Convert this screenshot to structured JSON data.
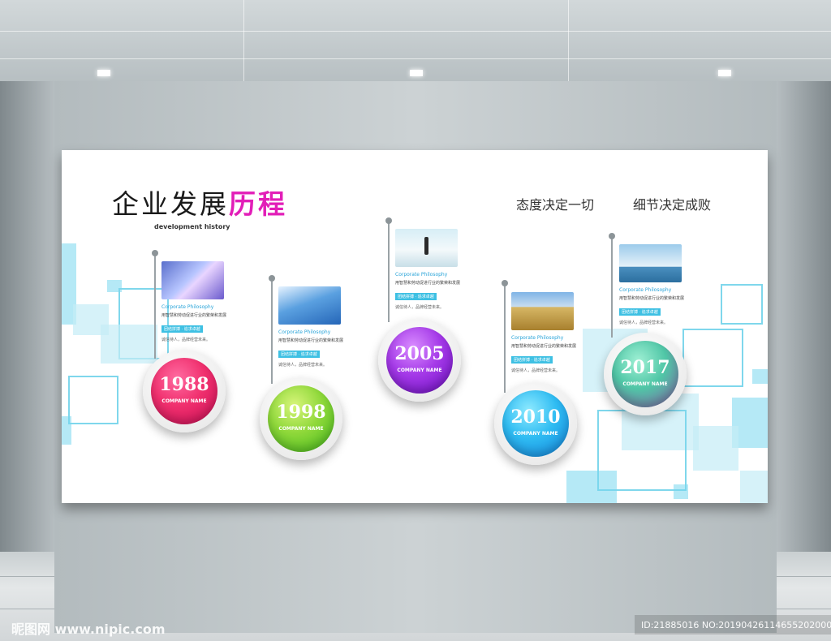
{
  "board": {
    "title_main": "企业发展",
    "title_accent": "历程",
    "subtitle": "development history",
    "slogan_1": "态度决定一切",
    "slogan_2": "细节决定成败"
  },
  "milestones": [
    {
      "year": "1988",
      "company": "COMPANY NAME",
      "photo": "handshake-photo",
      "color_top": "#f0306e",
      "color_bottom": "#d0105a",
      "philosophy": "Corporate Philosophy",
      "desc": "用智慧和劳动促进行业的繁荣和发展",
      "tag": "团结拼搏 · 追求卓越",
      "note": "诚信待人，品牌经营未来。"
    },
    {
      "year": "1998",
      "company": "COMPANY NAME",
      "photo": "building-photo",
      "color_top": "#b4e03a",
      "color_bottom": "#52c21a",
      "philosophy": "Corporate Philosophy",
      "desc": "用智慧和劳动促进行业的繁荣和发展",
      "tag": "团结拼搏 · 追求卓越",
      "note": "诚信待人，品牌经营未来。"
    },
    {
      "year": "2005",
      "company": "COMPANY NAME",
      "photo": "businessman-photo",
      "color_top": "#b83ef0",
      "color_bottom": "#7a12c8",
      "philosophy": "Corporate Philosophy",
      "desc": "用智慧和劳动促进行业的繁荣和发展",
      "tag": "团结拼搏 · 追求卓越",
      "note": "诚信待人，品牌经营未来。"
    },
    {
      "year": "2010",
      "company": "COMPANY NAME",
      "photo": "wheat-photo",
      "color_top": "#3fd0f5",
      "color_bottom": "#1a86e0",
      "philosophy": "Corporate Philosophy",
      "desc": "用智慧和劳动促进行业的繁荣和发展",
      "tag": "团结拼搏 · 追求卓越",
      "note": "诚信待人，品牌经营未来。"
    },
    {
      "year": "2017",
      "company": "COMPANY NAME",
      "photo": "city-photo",
      "color_top": "#5fd6b0",
      "color_bottom": "#8a4fa8",
      "philosophy": "Corporate Philosophy",
      "desc": "用智慧和劳动促进行业的繁荣和发展",
      "tag": "团结拼搏 · 追求卓越",
      "note": "诚信待人，品牌经营未来。"
    }
  ],
  "watermark": {
    "site": "昵图网 www.nipic.com",
    "id": "ID:21885016 NO:20190426114655202000"
  }
}
